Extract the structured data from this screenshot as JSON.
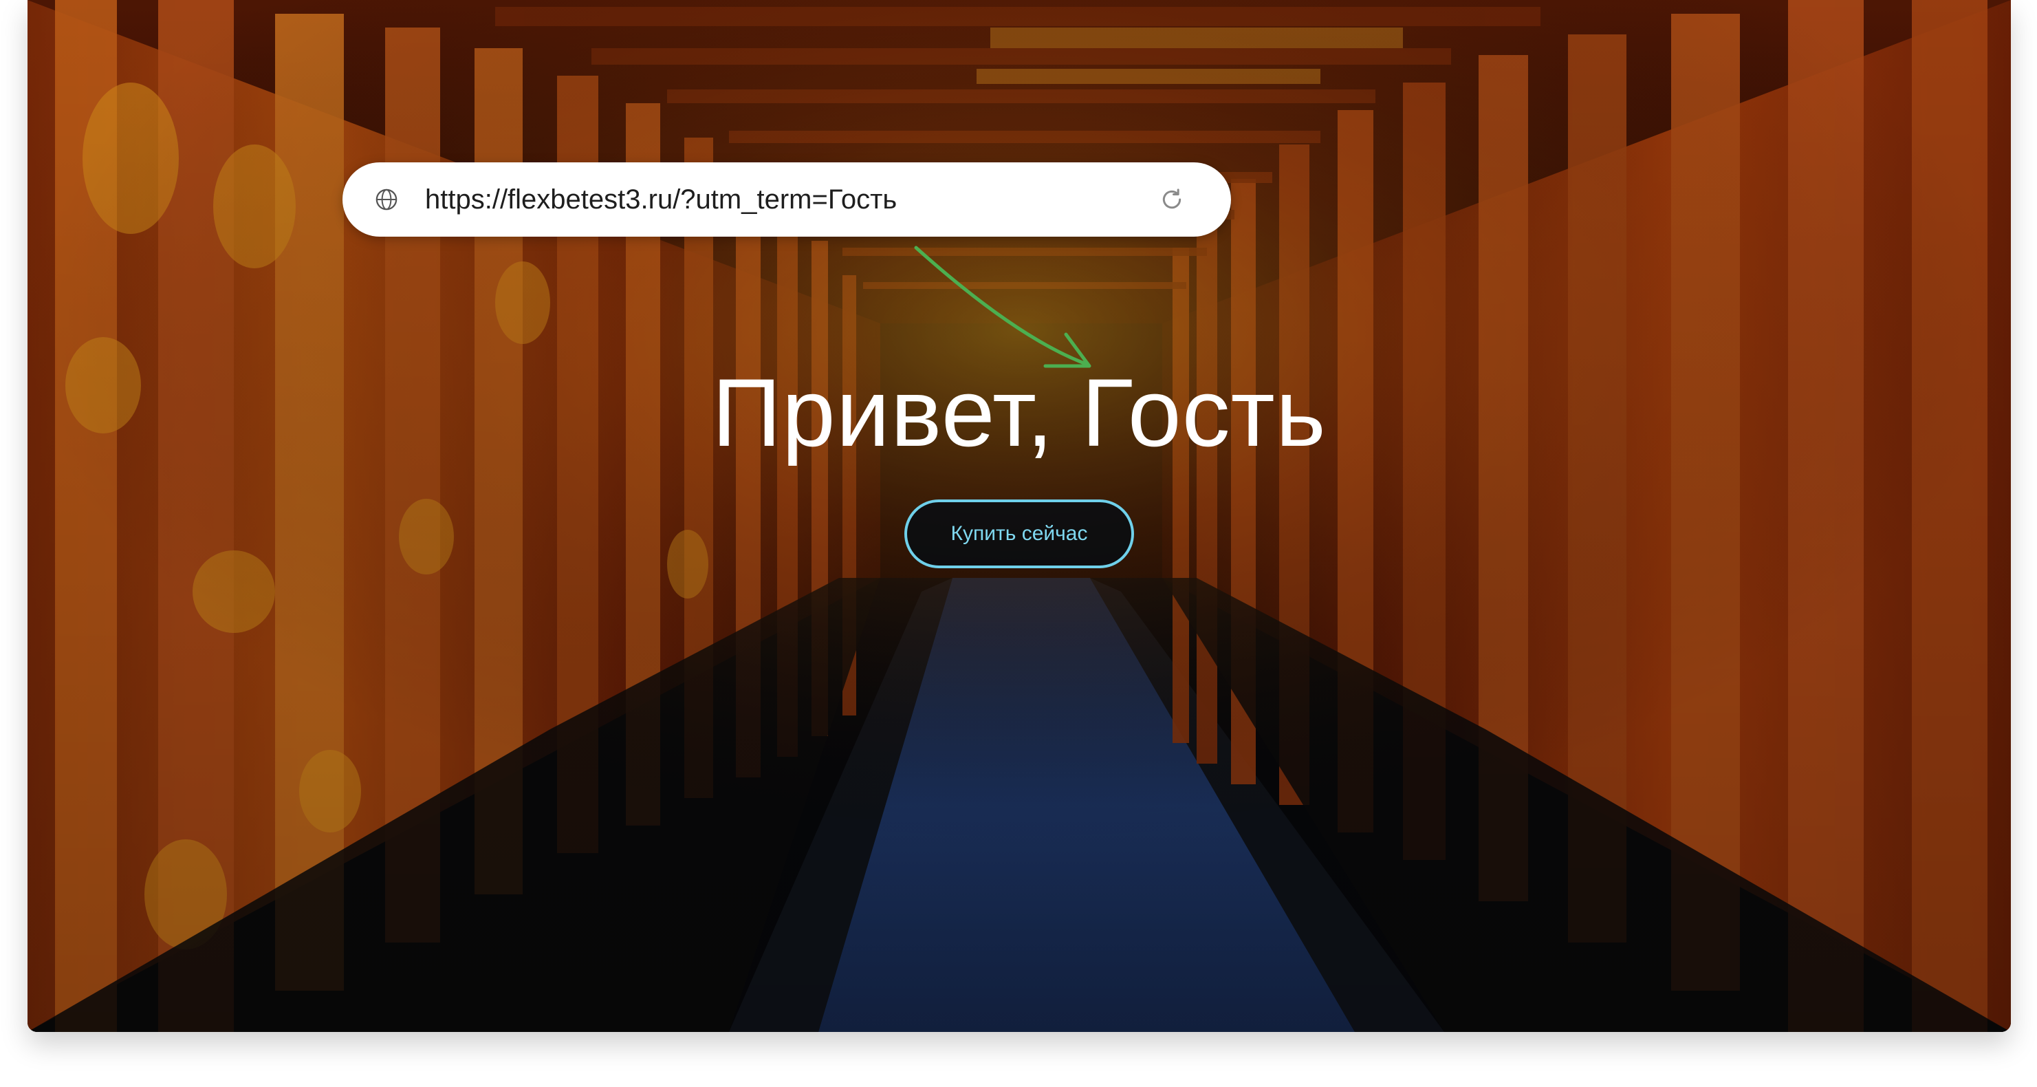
{
  "browser": {
    "url": "https://flexbetest3.ru/?utm_term=Гость",
    "globe_icon": "globe-icon",
    "reload_icon": "reload-icon"
  },
  "hero": {
    "headline": "Привет, Гость",
    "cta_label": "Купить сейчас",
    "background": "torii-gate-tunnel-photo"
  },
  "annotation": {
    "arrow_icon": "arrow-pointer-icon",
    "arrow_color": "#4caf50"
  },
  "colors": {
    "cta_accent": "#6fd0ea",
    "headline": "#ffffff"
  }
}
